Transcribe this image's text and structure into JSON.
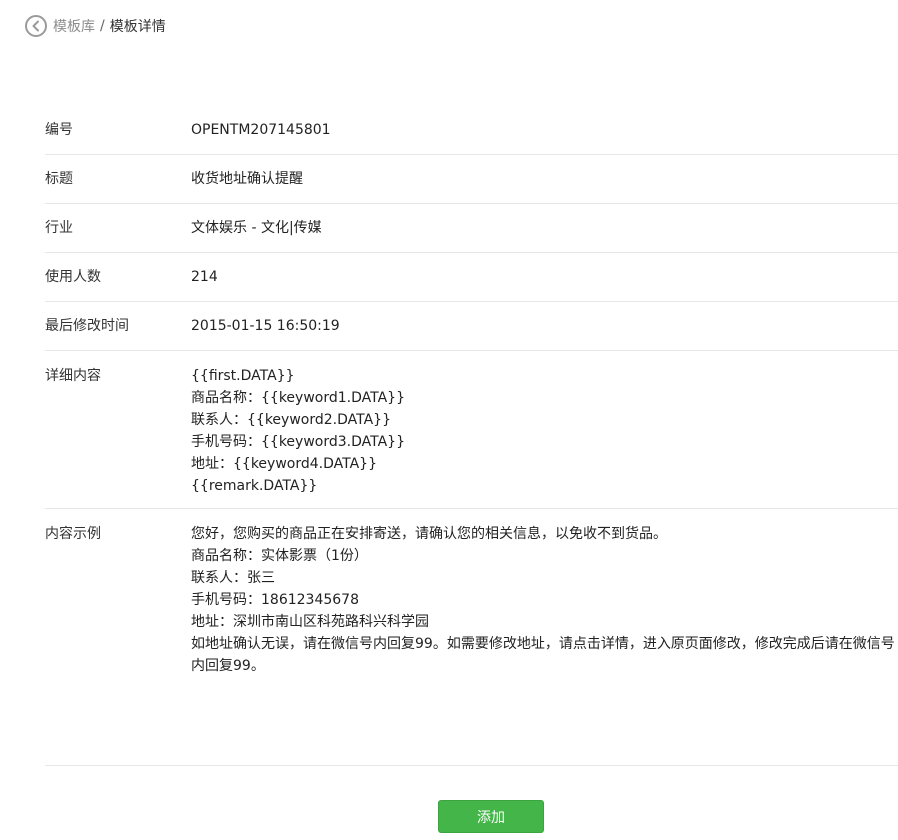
{
  "breadcrumb": {
    "parent": "模板库",
    "separator": "/",
    "current": "模板详情"
  },
  "fields": {
    "id": {
      "label": "编号",
      "value": "OPENTM207145801"
    },
    "title": {
      "label": "标题",
      "value": "收货地址确认提醒"
    },
    "industry": {
      "label": "行业",
      "value": "文体娱乐 - 文化|传媒"
    },
    "users": {
      "label": "使用人数",
      "value": "214"
    },
    "modified": {
      "label": "最后修改时间",
      "value": "2015-01-15 16:50:19"
    },
    "detail": {
      "label": "详细内容",
      "lines": [
        "{{first.DATA}}",
        "商品名称：{{keyword1.DATA}}",
        "联系人：{{keyword2.DATA}}",
        "手机号码：{{keyword3.DATA}}",
        "地址：{{keyword4.DATA}}",
        "{{remark.DATA}}"
      ]
    },
    "example": {
      "label": "内容示例",
      "lines": [
        "您好，您购买的商品正在安排寄送，请确认您的相关信息，以免收不到货品。",
        "商品名称：实体影票（1份）",
        "联系人：张三",
        "手机号码：18612345678",
        "地址：深圳市南山区科苑路科兴科学园",
        "如地址确认无误，请在微信号内回复99。如需要修改地址，请点击详情，进入原页面修改，修改完成后请在微信号内回复99。"
      ]
    }
  },
  "actions": {
    "add_label": "添加"
  },
  "colors": {
    "primary_green": "#44b549"
  }
}
